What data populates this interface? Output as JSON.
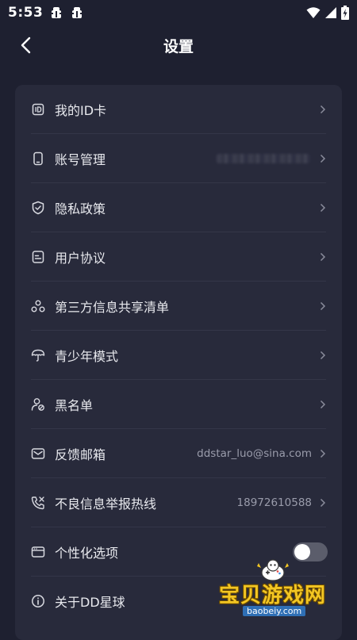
{
  "status_bar": {
    "time": "5:53"
  },
  "header": {
    "title": "设置"
  },
  "settings": [
    {
      "label": "我的ID卡",
      "icon": "id-card-icon",
      "value": ""
    },
    {
      "label": "账号管理",
      "icon": "phone-icon",
      "value": ""
    },
    {
      "label": "隐私政策",
      "icon": "shield-icon",
      "value": ""
    },
    {
      "label": "用户协议",
      "icon": "document-icon",
      "value": ""
    },
    {
      "label": "第三方信息共享清单",
      "icon": "share-nodes-icon",
      "value": ""
    },
    {
      "label": "青少年模式",
      "icon": "umbrella-icon",
      "value": ""
    },
    {
      "label": "黑名单",
      "icon": "user-block-icon",
      "value": ""
    },
    {
      "label": "反馈邮箱",
      "icon": "mail-icon",
      "value": "ddstar_luo@sina.com"
    },
    {
      "label": "不良信息举报热线",
      "icon": "phone-call-icon",
      "value": "18972610588"
    },
    {
      "label": "个性化选项",
      "icon": "window-icon",
      "value": "",
      "toggle_on": false
    },
    {
      "label": "关于DD星球",
      "icon": "info-icon",
      "value": ""
    }
  ],
  "watermark": {
    "text": "宝贝游戏网",
    "url": "baobeiy.com"
  },
  "colors": {
    "background": "#1e2030",
    "card": "#282a3b",
    "text": "#e8e9ee",
    "secondary_text": "#9a9cab",
    "toggle_off": "#5b5d6b"
  }
}
